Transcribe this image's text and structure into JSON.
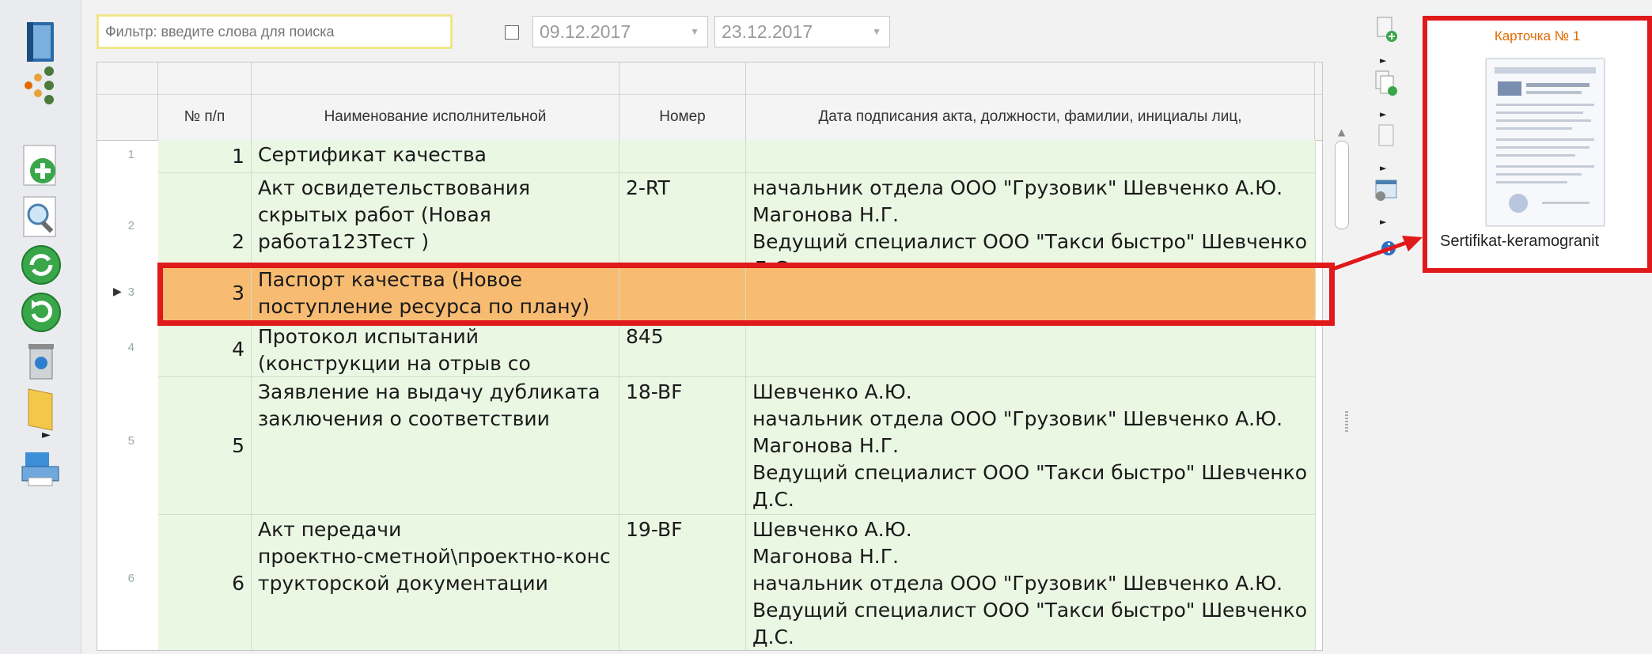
{
  "filter": {
    "placeholder": "Фильтр: введите слова для поиска",
    "date_from": "09.12.2017",
    "date_to": "23.12.2017"
  },
  "grid": {
    "headers": [
      "№ п/п",
      "Наименование исполнительной",
      "Номер",
      "Дата подписания акта, должности, фамилии, инициалы лиц,"
    ],
    "rows": [
      {
        "rn": "1",
        "num": "1",
        "name": "Сертификат качества",
        "no": "",
        "date": ""
      },
      {
        "rn": "2",
        "num": "2",
        "name": "Акт освидетельствования\nскрытых работ (Новая\nработа123Тест )",
        "no": "2-RT",
        "date": "начальник отдела ООО \"Грузовик\" Шевченко А.Ю.\n Магонова Н.Г.\nВедущий специалист ООО \"Такси быстро\" Шевченко Д.С.\nВедущий специалист ЗАО \"Морпорт\" Магонова Н.Г."
      },
      {
        "rn": "3",
        "num": "3",
        "name": "Паспорт качества (Новое\nпоступление ресурса по плану)",
        "no": "",
        "date": ""
      },
      {
        "rn": "4",
        "num": "4",
        "name": "Протокол испытаний\n(конструкции на отрыв со",
        "no": "845",
        "date": ""
      },
      {
        "rn": "5",
        "num": "5",
        "name": "Заявление на выдачу дубликата\nзаключения о соответствии",
        "no": "18-BF",
        "date": " Шевченко А.Ю.\nначальник отдела ООО \"Грузовик\" Шевченко А.Ю.\n Магонова Н.Г.\nВедущий специалист ООО \"Такси быстро\" Шевченко Д.С.\nВедущий специалист ЗАО \"Морпорт\" Магонова Н.Г."
      },
      {
        "rn": "6",
        "num": "6",
        "name": "Акт передачи\nпроектно-сметной\\проектно-конс\nтрукторской документации",
        "no": "19-BF",
        "date": " Шевченко А.Ю.\n Магонова Н.Г.\nначальник отдела ООО \"Грузовик\" Шевченко А.Ю.\nВедущий специалист ООО \"Такси быстро\" Шевченко Д.С.\nВедущий специалист ЗАО \"Морпорт\" Магонова Н.Г."
      }
    ]
  },
  "card": {
    "title": "Карточка № 1",
    "caption": "Sertifikat-keramogranit"
  },
  "colors": {
    "selected_row": "#f7bc72",
    "row_bg": "#eaf7e3",
    "highlight": "#e0191b",
    "card_title": "#e06a00"
  },
  "icons": {
    "left": [
      "book-icon",
      "dots-icon",
      "add-icon",
      "search-doc-icon",
      "refresh-icon",
      "reload-icon",
      "recycle-bin-icon",
      "folder-icon",
      "printer-icon"
    ],
    "right": [
      "add-doc-icon",
      "copy-doc-icon",
      "doc-icon",
      "settings-window-icon",
      "info-icon"
    ]
  }
}
